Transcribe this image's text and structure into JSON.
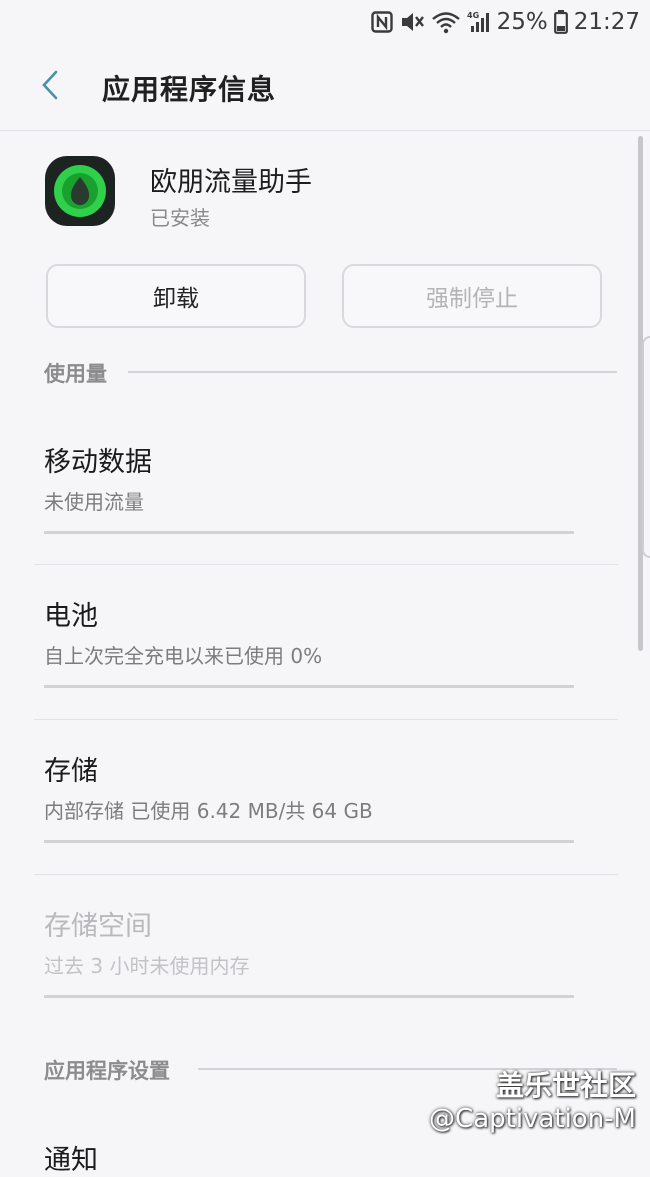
{
  "status_bar": {
    "battery": "25%",
    "time": "21:27"
  },
  "app_bar": {
    "title": "应用程序信息"
  },
  "app": {
    "name": "欧朋流量助手",
    "status": "已安装"
  },
  "buttons": {
    "uninstall": "卸载",
    "force_stop": "强制停止"
  },
  "sections": {
    "usage": "使用量",
    "settings": "应用程序设置"
  },
  "usage_items": [
    {
      "title": "移动数据",
      "subtitle": "未使用流量"
    },
    {
      "title": "电池",
      "subtitle": "自上次完全充电以来已使用 0%"
    },
    {
      "title": "存储",
      "subtitle": "内部存储 已使用 6.42 MB/共 64 GB"
    },
    {
      "title": "存储空间",
      "subtitle": "过去 3 小时未使用内存"
    }
  ],
  "settings_items": [
    {
      "title": "通知"
    }
  ],
  "watermark": {
    "title": "盖乐世社区",
    "handle": "@Captivation-M"
  },
  "colors": {
    "background": "#f6f5f8",
    "accent": "#4a90a8",
    "icon_green": "#2fd04a"
  }
}
